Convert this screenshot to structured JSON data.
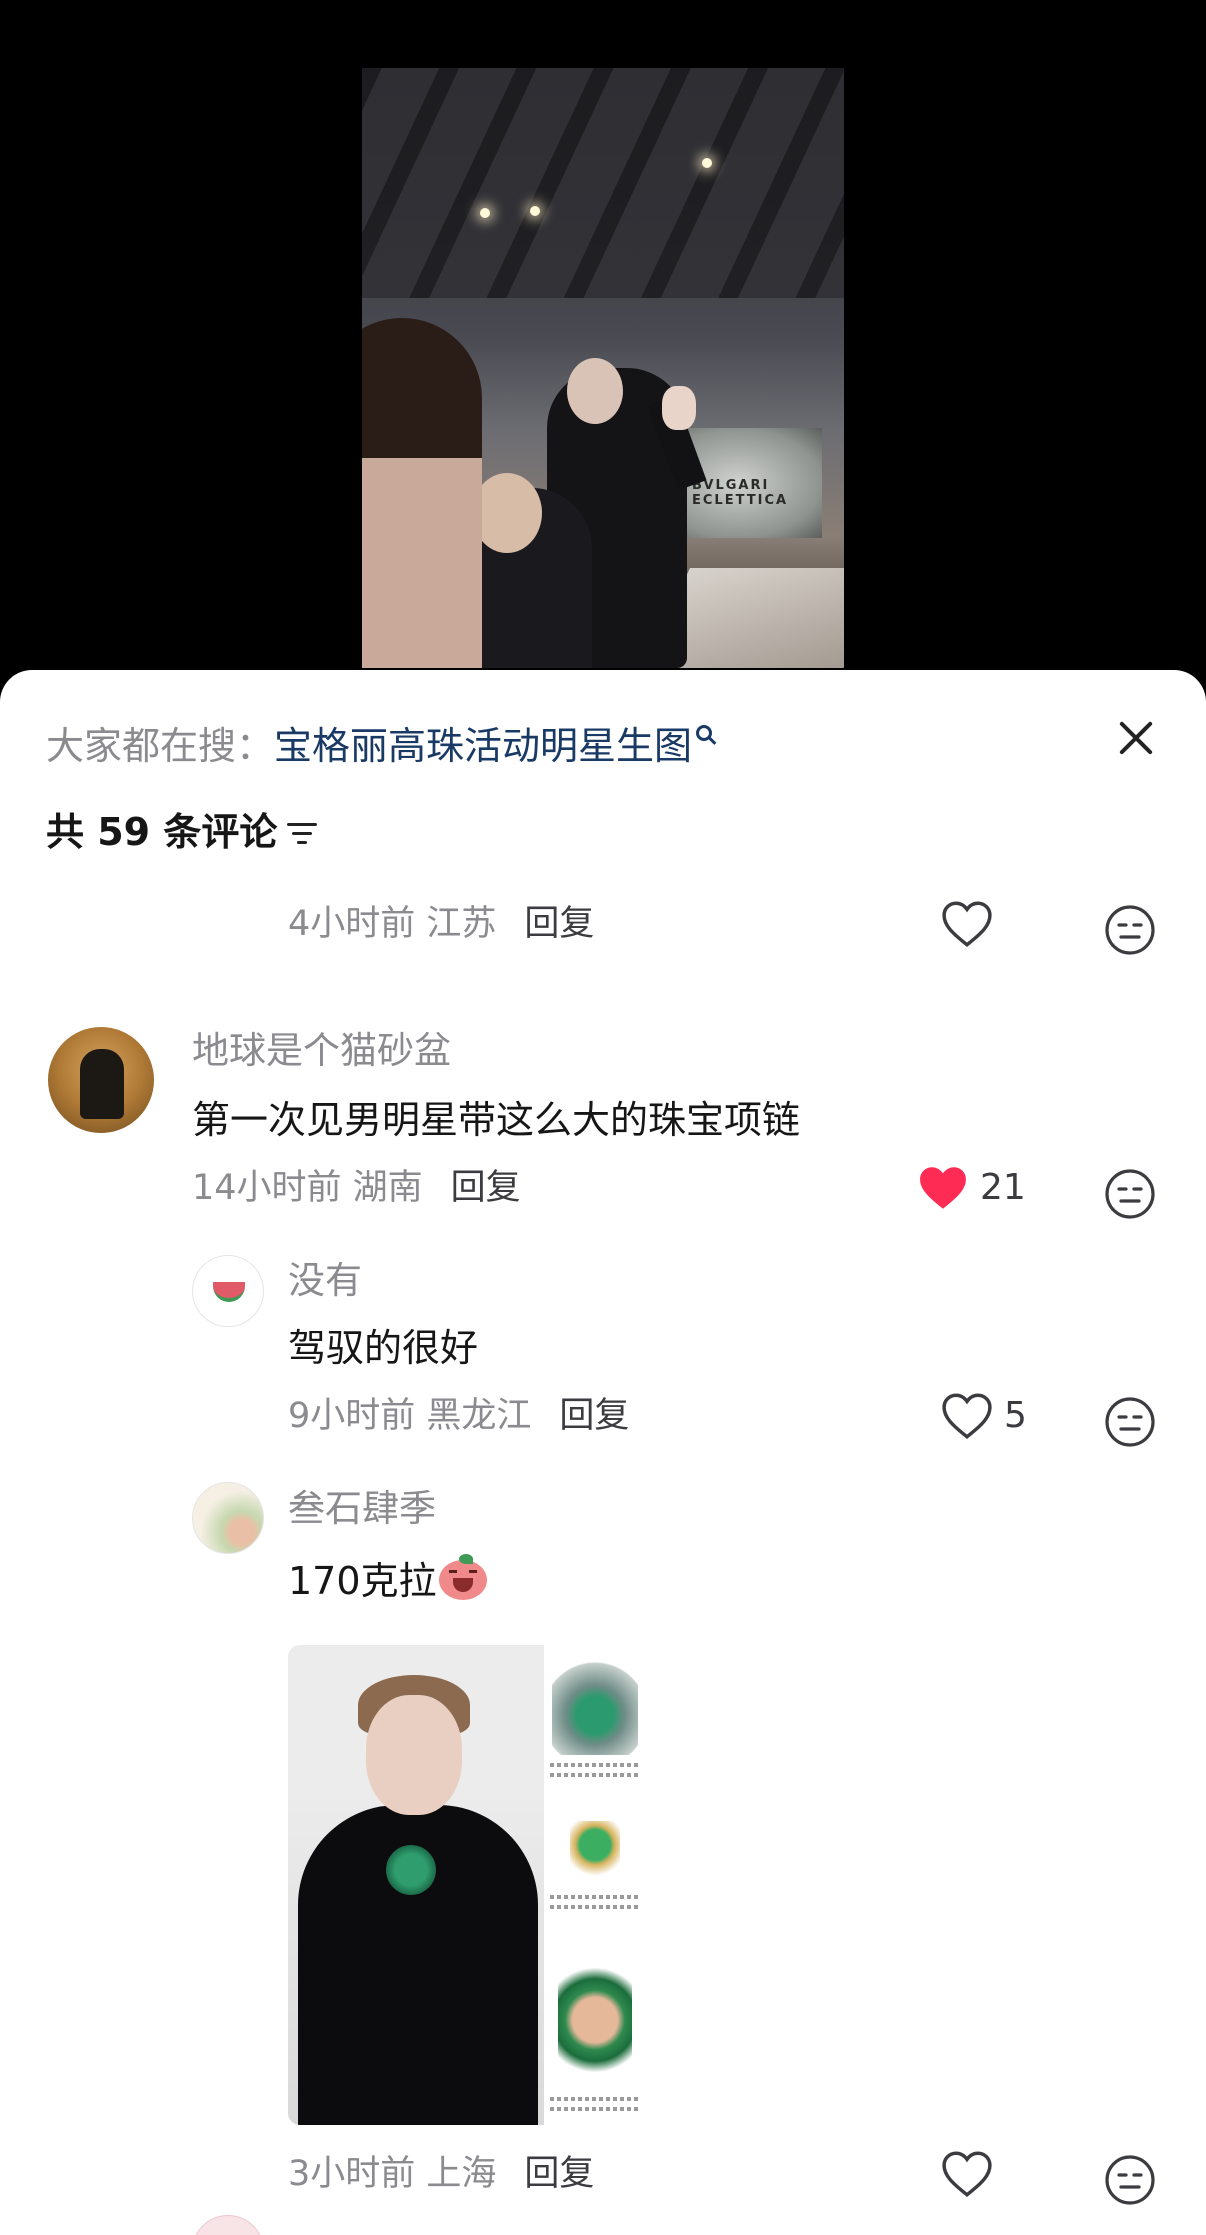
{
  "search_hint": {
    "label": "大家都在搜：",
    "term": "宝格丽高珠活动明星生图"
  },
  "comment_count": "共 59 条评论",
  "comments": [
    {
      "id": "c0",
      "meta_time_loc": "4小时前 江苏",
      "reply": "回复",
      "likes": "",
      "liked": false
    },
    {
      "id": "c1",
      "username": "地球是个猫砂盆",
      "text": "第一次见男明星带这么大的珠宝项链",
      "meta_time_loc": "14小时前 湖南",
      "reply": "回复",
      "likes": "21",
      "liked": true,
      "replies": [
        {
          "id": "r1",
          "username": "没有",
          "text": "驾驭的很好",
          "meta_time_loc": "9小时前 黑龙江",
          "reply": "回复",
          "likes": "5",
          "liked": false
        },
        {
          "id": "r2",
          "username": "叁石肆季",
          "text": "170克拉",
          "has_image": true,
          "meta_time_loc": "3小时前 上海",
          "reply": "回复",
          "likes": "",
          "liked": false
        }
      ]
    }
  ],
  "image_overlay_text": "BVLGARI ECLETTICA",
  "colors": {
    "accent_like": "#fe2c55",
    "search_term": "#1a3a66",
    "meta": "#8a8a8f"
  },
  "icons": [
    "close-icon",
    "sort-icon",
    "heart-icon",
    "emoji-icon",
    "search-icon"
  ]
}
